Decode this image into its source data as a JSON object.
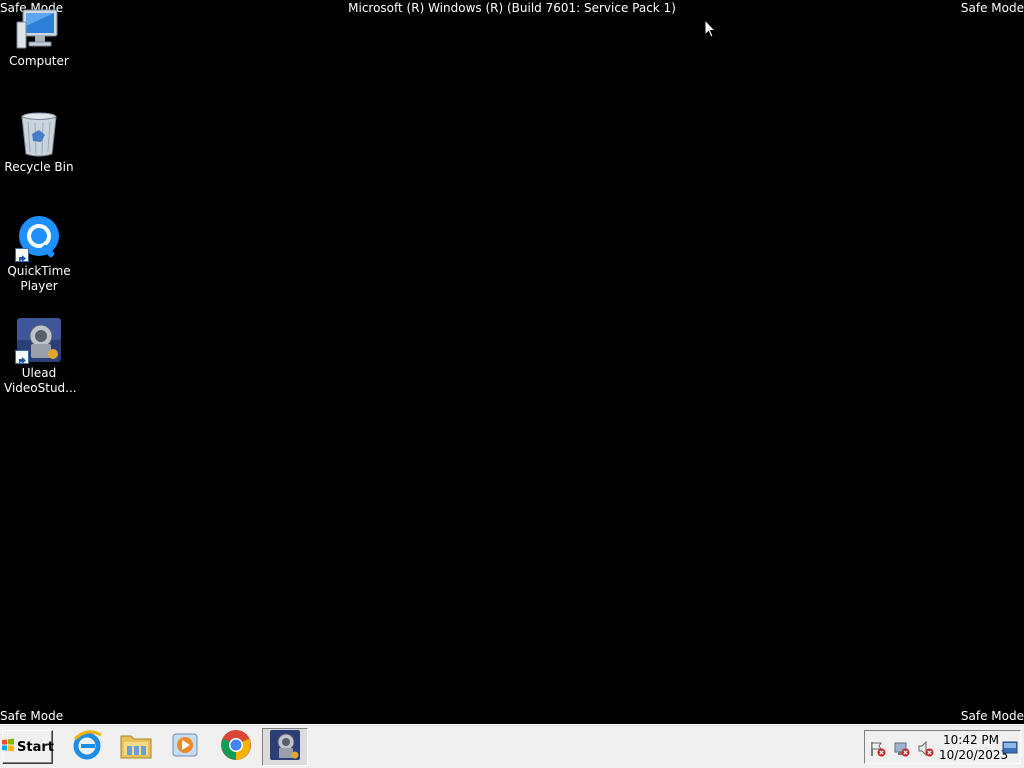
{
  "screen": {
    "safe_mode_top_left": "Safe Mode",
    "safe_mode_top_right": "Safe Mode",
    "safe_mode_bottom_left": "Safe Mode",
    "safe_mode_bottom_right": "Safe Mode",
    "build_text": "Microsoft (R) Windows (R) (Build 7601: Service Pack 1)",
    "background_color": "#000000"
  },
  "desktop_icons": [
    {
      "label": "Computer",
      "icon": "computer-icon"
    },
    {
      "label": "Recycle Bin",
      "icon": "recycle-bin-icon"
    },
    {
      "label_line1": "QuickTime",
      "label_line2": "Player",
      "icon": "quicktime-icon",
      "shortcut": true
    },
    {
      "label_line1": "Ulead",
      "label_line2": "VideoStud...",
      "icon": "ulead-videostudio-icon",
      "shortcut": true
    }
  ],
  "taskbar": {
    "start_label": "Start",
    "pinned_apps": [
      {
        "name": "Internet Explorer",
        "icon": "internet-explorer-icon"
      },
      {
        "name": "Windows Explorer",
        "icon": "folder-icon"
      },
      {
        "name": "Windows Media Player",
        "icon": "media-player-icon"
      },
      {
        "name": "Google Chrome",
        "icon": "chrome-icon"
      },
      {
        "name": "Ulead VideoStudio",
        "icon": "ulead-videostudio-icon",
        "active": true
      }
    ],
    "tray": {
      "icons": [
        "action-center-flag-icon",
        "network-error-icon",
        "volume-muted-icon"
      ],
      "time": "10:42 PM",
      "date": "10/20/2023"
    }
  }
}
